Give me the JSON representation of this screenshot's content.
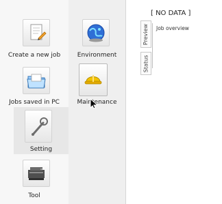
{
  "left_menu": [
    {
      "key": "create",
      "label": "Create a new job",
      "icon": "document-edit-icon"
    },
    {
      "key": "saved",
      "label": "Jobs saved in PC",
      "icon": "folder-open-icon"
    },
    {
      "key": "setting",
      "label": "Setting",
      "icon": "wrench-icon",
      "selected": true
    },
    {
      "key": "tool",
      "label": "Tool",
      "icon": "printer-machine-icon"
    }
  ],
  "middle_menu": [
    {
      "key": "environment",
      "label": "Environment",
      "icon": "globe-icon"
    },
    {
      "key": "maintenance",
      "label": "Maintenance",
      "icon": "hard-hat-icon"
    }
  ],
  "right": {
    "title": "[ NO DATA ]",
    "tabs": [
      "Preview",
      "Status"
    ],
    "content": "Job overview"
  },
  "colors": {
    "accent": "#4b8fd2",
    "helmet": "#f2c200"
  }
}
